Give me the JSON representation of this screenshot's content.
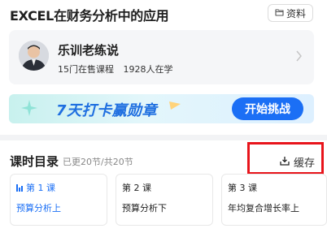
{
  "header": {
    "title": "EXCEL在财务分析中的应用",
    "materials_label": "资料"
  },
  "teacher": {
    "name": "乐训老练说",
    "courses": "15门在售课程",
    "learners": "1928人在学"
  },
  "banner": {
    "text": "7天打卡赢勋章",
    "button_label": "开始挑战"
  },
  "section": {
    "title": "课时目录",
    "subtitle": "已更20节/共20节",
    "cache_label": "缓存"
  },
  "lessons": [
    {
      "number": "第 1 课",
      "name": "预算分析上",
      "active": true
    },
    {
      "number": "第 2 课",
      "name": "预算分析下",
      "active": false
    },
    {
      "number": "第 3 课",
      "name": "年均复合增长率上",
      "active": false
    }
  ],
  "colors": {
    "accent": "#1b6ff5",
    "highlight": "#e8141b"
  },
  "icons": {
    "materials": "folder-icon",
    "cache": "download-icon",
    "arrow": "chevron-right-icon",
    "playing": "playing-bars-icon"
  }
}
